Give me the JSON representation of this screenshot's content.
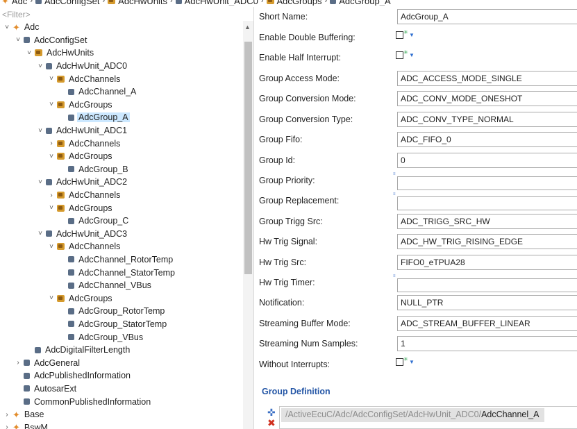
{
  "breadcrumb": [
    "Adc",
    "AdcConfigSet",
    "AdcHwUnits",
    "AdcHwUnit_ADC0",
    "AdcGroups",
    "AdcGroup_A"
  ],
  "filter": {
    "placeholder": "<Filter>"
  },
  "tree": [
    {
      "label": "Adc",
      "depth": 0,
      "twisty": "open",
      "icon": "module-icon"
    },
    {
      "label": "AdcConfigSet",
      "depth": 1,
      "twisty": "open",
      "icon": "container-icon"
    },
    {
      "label": "AdcHwUnits",
      "depth": 2,
      "twisty": "open",
      "icon": "folder-icon"
    },
    {
      "label": "AdcHwUnit_ADC0",
      "depth": 3,
      "twisty": "open",
      "icon": "container-icon"
    },
    {
      "label": "AdcChannels",
      "depth": 4,
      "twisty": "open",
      "icon": "folder-icon"
    },
    {
      "label": "AdcChannel_A",
      "depth": 5,
      "twisty": "none",
      "icon": "container-icon"
    },
    {
      "label": "AdcGroups",
      "depth": 4,
      "twisty": "open",
      "icon": "folder-icon"
    },
    {
      "label": "AdcGroup_A",
      "depth": 5,
      "twisty": "none",
      "icon": "container-icon",
      "selected": true
    },
    {
      "label": "AdcHwUnit_ADC1",
      "depth": 3,
      "twisty": "open",
      "icon": "container-icon"
    },
    {
      "label": "AdcChannels",
      "depth": 4,
      "twisty": "closed",
      "icon": "folder-icon"
    },
    {
      "label": "AdcGroups",
      "depth": 4,
      "twisty": "open",
      "icon": "folder-icon"
    },
    {
      "label": "AdcGroup_B",
      "depth": 5,
      "twisty": "none",
      "icon": "container-icon"
    },
    {
      "label": "AdcHwUnit_ADC2",
      "depth": 3,
      "twisty": "open",
      "icon": "container-icon"
    },
    {
      "label": "AdcChannels",
      "depth": 4,
      "twisty": "closed",
      "icon": "folder-icon"
    },
    {
      "label": "AdcGroups",
      "depth": 4,
      "twisty": "open",
      "icon": "folder-icon"
    },
    {
      "label": "AdcGroup_C",
      "depth": 5,
      "twisty": "none",
      "icon": "container-icon"
    },
    {
      "label": "AdcHwUnit_ADC3",
      "depth": 3,
      "twisty": "open",
      "icon": "container-icon"
    },
    {
      "label": "AdcChannels",
      "depth": 4,
      "twisty": "open",
      "icon": "folder-icon"
    },
    {
      "label": "AdcChannel_RotorTemp",
      "depth": 5,
      "twisty": "none",
      "icon": "container-icon"
    },
    {
      "label": "AdcChannel_StatorTemp",
      "depth": 5,
      "twisty": "none",
      "icon": "container-icon"
    },
    {
      "label": "AdcChannel_VBus",
      "depth": 5,
      "twisty": "none",
      "icon": "container-icon"
    },
    {
      "label": "AdcGroups",
      "depth": 4,
      "twisty": "open",
      "icon": "folder-icon"
    },
    {
      "label": "AdcGroup_RotorTemp",
      "depth": 5,
      "twisty": "none",
      "icon": "container-icon"
    },
    {
      "label": "AdcGroup_StatorTemp",
      "depth": 5,
      "twisty": "none",
      "icon": "container-icon"
    },
    {
      "label": "AdcGroup_VBus",
      "depth": 5,
      "twisty": "none",
      "icon": "container-icon"
    },
    {
      "label": "AdcDigitalFilterLength",
      "depth": 2,
      "twisty": "none",
      "icon": "container-icon"
    },
    {
      "label": "AdcGeneral",
      "depth": 1,
      "twisty": "closed",
      "icon": "container-icon"
    },
    {
      "label": "AdcPublishedInformation",
      "depth": 1,
      "twisty": "none",
      "icon": "container-icon"
    },
    {
      "label": "AutosarExt",
      "depth": 1,
      "twisty": "none",
      "icon": "container-icon"
    },
    {
      "label": "CommonPublishedInformation",
      "depth": 1,
      "twisty": "none",
      "icon": "container-icon"
    },
    {
      "label": "Base",
      "depth": 0,
      "twisty": "closed",
      "icon": "module-icon"
    },
    {
      "label": "BswM",
      "depth": 0,
      "twisty": "closed",
      "icon": "module-icon"
    }
  ],
  "form": [
    {
      "label": "Short Name:",
      "kind": "text",
      "value": "AdcGroup_A"
    },
    {
      "label": "Enable Double Buffering:",
      "kind": "checkbox"
    },
    {
      "label": "Enable Half Interrupt:",
      "kind": "checkbox"
    },
    {
      "label": "Group Access Mode:",
      "kind": "text",
      "value": "ADC_ACCESS_MODE_SINGLE"
    },
    {
      "label": "Group Conversion Mode:",
      "kind": "text",
      "value": "ADC_CONV_MODE_ONESHOT"
    },
    {
      "label": "Group Conversion Type:",
      "kind": "text",
      "value": "ADC_CONV_TYPE_NORMAL"
    },
    {
      "label": "Group Fifo:",
      "kind": "text",
      "value": "ADC_FIFO_0"
    },
    {
      "label": "Group Id:",
      "kind": "text",
      "value": "0"
    },
    {
      "label": "Group Priority:",
      "kind": "empty"
    },
    {
      "label": "Group Replacement:",
      "kind": "empty"
    },
    {
      "label": "Group Trigg Src:",
      "kind": "text",
      "value": "ADC_TRIGG_SRC_HW"
    },
    {
      "label": "Hw Trig Signal:",
      "kind": "text",
      "value": "ADC_HW_TRIG_RISING_EDGE"
    },
    {
      "label": "Hw Trig Src:",
      "kind": "text",
      "value": "FIFO0_eTPUA28"
    },
    {
      "label": "Hw Trig Timer:",
      "kind": "empty"
    },
    {
      "label": "Notification:",
      "kind": "text",
      "value": "NULL_PTR"
    },
    {
      "label": "Streaming Buffer Mode:",
      "kind": "text",
      "value": "ADC_STREAM_BUFFER_LINEAR"
    },
    {
      "label": "Streaming Num Samples:",
      "kind": "text",
      "value": "1"
    },
    {
      "label": "Without Interrupts:",
      "kind": "checkbox"
    }
  ],
  "group_definition": {
    "title": "Group Definition",
    "item_path": "/ActiveEcuC/Adc/AdcConfigSet/AdcHwUnit_ADC0/",
    "item_leaf": "AdcChannel_A"
  },
  "icons": {
    "add": "add-icon",
    "remove": "remove-icon",
    "dropdown": "dropdown-arrow-icon",
    "checkbox_star": "default-value-icon"
  },
  "colors": {
    "selection": "#cce8ff",
    "section_title": "#2456a6",
    "remove": "#d0301f",
    "module": "#e28c2b",
    "folder": "#d59a2d",
    "container": "#5a6d86"
  }
}
